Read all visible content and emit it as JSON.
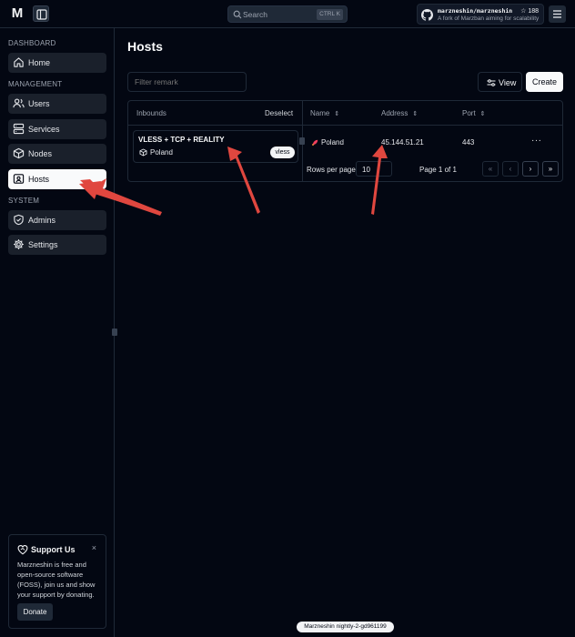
{
  "app": {
    "logo_text": "M",
    "search": {
      "label": "Search",
      "shortcut": "CTRL K"
    },
    "repo": {
      "name": "marzneshin/marzneshin",
      "stars": "☆ 188",
      "description": "A fork of Marzban aiming for scalability"
    },
    "version": "Marzneshin nightly-2-gd961199"
  },
  "sidebar": {
    "sections": [
      {
        "title": "DASHBOARD",
        "items": [
          {
            "label": "Home",
            "icon": "home-icon"
          }
        ]
      },
      {
        "title": "MANAGEMENT",
        "items": [
          {
            "label": "Users",
            "icon": "users-icon"
          },
          {
            "label": "Services",
            "icon": "server-icon"
          },
          {
            "label": "Nodes",
            "icon": "box-icon"
          },
          {
            "label": "Hosts",
            "icon": "hosts-icon",
            "active": true
          }
        ]
      },
      {
        "title": "SYSTEM",
        "items": [
          {
            "label": "Admins",
            "icon": "shield-icon"
          },
          {
            "label": "Settings",
            "icon": "gear-icon"
          }
        ]
      }
    ]
  },
  "support": {
    "title": "Support Us",
    "text": "Marzneshin is free and open-source software (FOSS), join us and show your support by donating.",
    "donate_label": "Donate",
    "close": "×"
  },
  "main": {
    "title": "Hosts",
    "filter_placeholder": "Filter remark",
    "view_label": "View",
    "create_label": "Create",
    "inbounds_header": "Inbounds",
    "deselect_label": "Deselect",
    "inbound": {
      "title": "VLESS + TCP + REALITY",
      "country": "Poland",
      "protocol": "vless"
    },
    "columns": [
      {
        "label": "Name",
        "sort": "⇕"
      },
      {
        "label": "Address",
        "sort": "⇕"
      },
      {
        "label": "Port",
        "sort": "⇕"
      }
    ],
    "rows": [
      {
        "name": "Poland",
        "address": "45.144.51.21",
        "port": "443",
        "menu": "···"
      }
    ],
    "pagination": {
      "rows_per_page_label": "Rows per page",
      "rows_per_page_value": "10",
      "page_info": "Page 1 of 1",
      "first": "«",
      "prev": "‹",
      "next": "›",
      "last": "»"
    }
  },
  "colors": {
    "annotation_arrow": "#e0473f",
    "background": "#030712"
  }
}
